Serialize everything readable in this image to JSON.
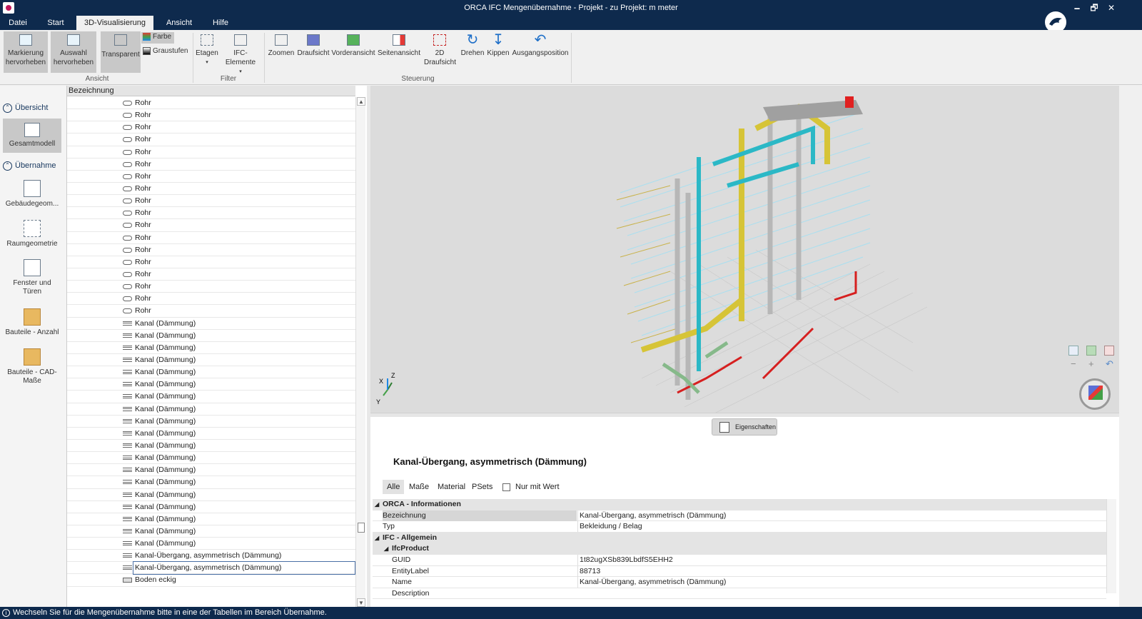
{
  "window": {
    "title": "ORCA IFC Mengenübernahme - Projekt - zu Projekt: m meter",
    "minimize": "🗕",
    "restore": "🗗",
    "close": "✕"
  },
  "tabs": [
    "Datei",
    "Start",
    "3D-Visualisierung",
    "Ansicht",
    "Hilfe"
  ],
  "ribbon": {
    "markierung": "Markierung hervorheben",
    "auswahl": "Auswahl hervorheben",
    "transparent": "Transparent",
    "farbe": "Farbe",
    "graustufen": "Graustufen",
    "etagen": "Etagen",
    "ifc": "IFC-Elemente",
    "zoomen": "Zoomen",
    "draufsicht": "Draufsicht",
    "vorderansicht": "Vorderansicht",
    "seitenansicht": "Seitenansicht",
    "draufsicht2d": "2D Draufsicht",
    "drehen": "Drehen",
    "kippen": "Kippen",
    "ausgang": "Ausgangsposition",
    "grp_ansicht": "Ansicht",
    "grp_filter": "Filter",
    "grp_steuerung": "Steuerung"
  },
  "sidebar": {
    "uebersicht": "Übersicht",
    "gesamtmodell": "Gesamtmodell",
    "uebernahme": "Übernahme",
    "gebaeude": "Gebäudegeom...",
    "raum": "Raumgeometrie",
    "fenster": "Fenster und Türen",
    "anzahl": "Bauteile - Anzahl",
    "cad": "Bauteile - CAD-Maße"
  },
  "tree": {
    "header": "Bezeichnung",
    "rows": [
      {
        "label": "Rohr",
        "icon": "pipe-icon"
      },
      {
        "label": "Rohr",
        "icon": "pipe-icon"
      },
      {
        "label": "Rohr",
        "icon": "pipe-icon"
      },
      {
        "label": "Rohr",
        "icon": "pipe-icon"
      },
      {
        "label": "Rohr",
        "icon": "pipe-icon"
      },
      {
        "label": "Rohr",
        "icon": "pipe-icon"
      },
      {
        "label": "Rohr",
        "icon": "pipe-icon"
      },
      {
        "label": "Rohr",
        "icon": "pipe-icon"
      },
      {
        "label": "Rohr",
        "icon": "pipe-icon"
      },
      {
        "label": "Rohr",
        "icon": "pipe-icon"
      },
      {
        "label": "Rohr",
        "icon": "pipe-icon"
      },
      {
        "label": "Rohr",
        "icon": "pipe-icon"
      },
      {
        "label": "Rohr",
        "icon": "pipe-icon"
      },
      {
        "label": "Rohr",
        "icon": "pipe-icon"
      },
      {
        "label": "Rohr",
        "icon": "pipe-icon"
      },
      {
        "label": "Rohr",
        "icon": "pipe-icon"
      },
      {
        "label": "Rohr",
        "icon": "pipe-icon"
      },
      {
        "label": "Rohr",
        "icon": "pipe-icon"
      },
      {
        "label": "Kanal (Dämmung)",
        "icon": "duct-icon"
      },
      {
        "label": "Kanal (Dämmung)",
        "icon": "duct-icon"
      },
      {
        "label": "Kanal (Dämmung)",
        "icon": "duct-icon"
      },
      {
        "label": "Kanal (Dämmung)",
        "icon": "duct-icon"
      },
      {
        "label": "Kanal (Dämmung)",
        "icon": "duct-icon"
      },
      {
        "label": "Kanal (Dämmung)",
        "icon": "duct-icon"
      },
      {
        "label": "Kanal (Dämmung)",
        "icon": "duct-icon"
      },
      {
        "label": "Kanal (Dämmung)",
        "icon": "duct-icon"
      },
      {
        "label": "Kanal (Dämmung)",
        "icon": "duct-icon"
      },
      {
        "label": "Kanal (Dämmung)",
        "icon": "duct-icon"
      },
      {
        "label": "Kanal (Dämmung)",
        "icon": "duct-icon"
      },
      {
        "label": "Kanal (Dämmung)",
        "icon": "duct-icon"
      },
      {
        "label": "Kanal (Dämmung)",
        "icon": "duct-icon"
      },
      {
        "label": "Kanal (Dämmung)",
        "icon": "duct-icon"
      },
      {
        "label": "Kanal (Dämmung)",
        "icon": "duct-icon"
      },
      {
        "label": "Kanal (Dämmung)",
        "icon": "duct-icon"
      },
      {
        "label": "Kanal (Dämmung)",
        "icon": "duct-icon"
      },
      {
        "label": "Kanal (Dämmung)",
        "icon": "duct-icon"
      },
      {
        "label": "Kanal (Dämmung)",
        "icon": "duct-icon"
      },
      {
        "label": "Kanal-Übergang, asymmetrisch (Dämmung)",
        "icon": "duct-icon"
      },
      {
        "label": "Kanal-Übergang, asymmetrisch (Dämmung)",
        "icon": "duct-icon",
        "selected": true
      },
      {
        "label": "Boden eckig",
        "icon": "slab-icon"
      }
    ]
  },
  "viewport": {
    "axis_x": "X",
    "axis_y": "Y",
    "axis_z": "Z"
  },
  "props": {
    "button": "Eigenschaften",
    "title": "Kanal-Übergang, asymmetrisch (Dämmung)",
    "tabs": [
      "Alle",
      "Maße",
      "Material",
      "PSets"
    ],
    "only_value": "Nur mit Wert",
    "rows": [
      {
        "type": "cat",
        "key": "ORCA - Informationen"
      },
      {
        "type": "row",
        "key": "Bezeichnung",
        "value": "Kanal-Übergang, asymmetrisch (Dämmung)",
        "hl": true
      },
      {
        "type": "row",
        "key": "Typ",
        "value": "Bekleidung / Belag"
      },
      {
        "type": "cat",
        "key": "IFC - Allgemein"
      },
      {
        "type": "sub",
        "key": "IfcProduct"
      },
      {
        "type": "row2",
        "key": "GUID",
        "value": "1t82ugXSb839LbdfS5EHH2"
      },
      {
        "type": "row2",
        "key": "EntityLabel",
        "value": "88713"
      },
      {
        "type": "row2",
        "key": "Name",
        "value": "Kanal-Übergang, asymmetrisch (Dämmung)"
      },
      {
        "type": "row2",
        "key": "Description",
        "value": ""
      }
    ]
  },
  "status": "Wechseln Sie für die Mengenübernahme bitte in eine der Tabellen im Bereich Übernahme.",
  "colors": {
    "titlebar": "#0e2a4d",
    "accent": "#17375e"
  }
}
